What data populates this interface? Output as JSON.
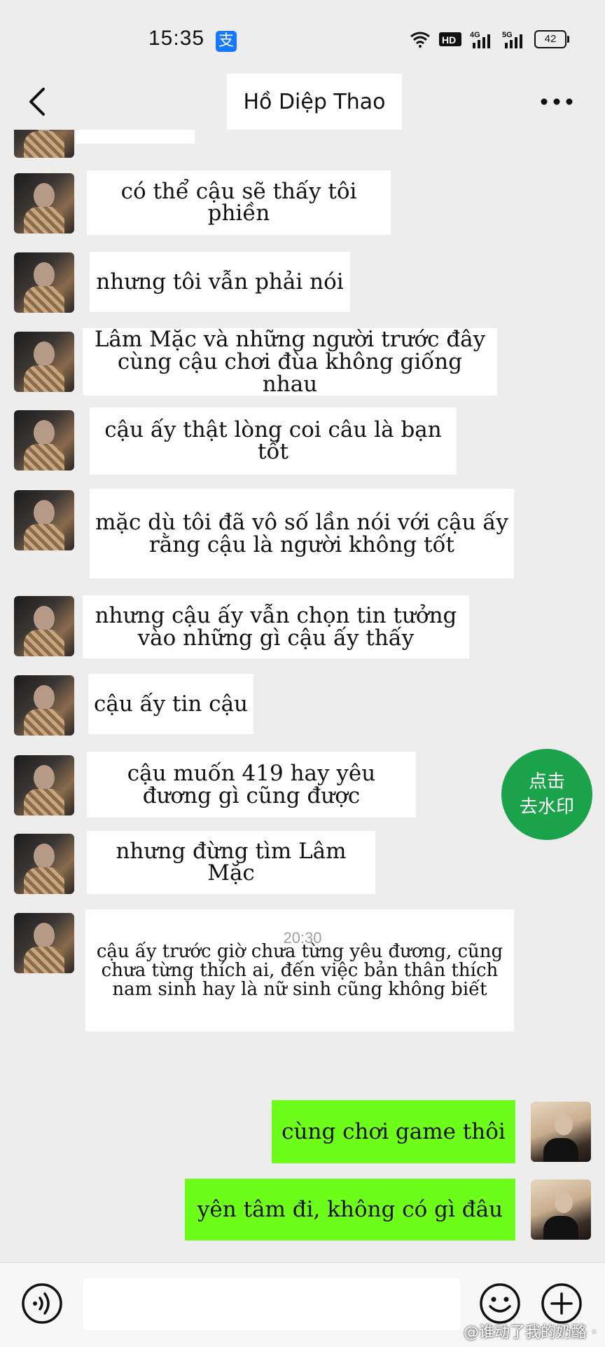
{
  "status_bar": {
    "time": "15:35",
    "app_icon": "alipay-icon",
    "network_labels": [
      "HD",
      "4G",
      "5G"
    ],
    "battery": "42"
  },
  "header": {
    "title": "Hồ Diệp Thao",
    "back_icon": "chevron-left-icon",
    "more_icon": "more-dots-icon"
  },
  "messages": [
    {
      "sender": "other",
      "text": "có thể cậu sẽ thấy tôi phiền"
    },
    {
      "sender": "other",
      "text": "nhưng tôi vẫn phải nói"
    },
    {
      "sender": "other",
      "text": "Lâm Mặc và những người trước đây\ncùng cậu chơi đùa không giống nhau"
    },
    {
      "sender": "other",
      "text": "cậu ấy thật lòng coi câu là bạn tốt"
    },
    {
      "sender": "other",
      "text": "mặc dù tôi đã vô số lần nói với cậu ấy\nrằng cậu là người không tốt"
    },
    {
      "sender": "other",
      "text": "nhưng cậu ấy vẫn chọn tin tưởng\nvào những gì cậu ấy thấy"
    },
    {
      "sender": "other",
      "text": "cậu ấy tin cậu"
    },
    {
      "sender": "other",
      "text": "cậu muốn 419 hay yêu\nđương gì cũng được"
    },
    {
      "sender": "other",
      "text": "nhưng đừng tìm Lâm Mặc"
    },
    {
      "sender": "other",
      "text": "cậu ấy trước giờ chưa từng yêu đương, cũng\nchưa từng thích ai, đến việc bản thân thích\nnam sinh hay là nữ sinh cũng không biết"
    },
    {
      "sender": "me",
      "text": "cùng chơi game thôi"
    },
    {
      "sender": "me",
      "text": "yên tâm đi, không có gì đâu"
    }
  ],
  "timestamp": "20:30",
  "watermark_button": {
    "line1": "点击",
    "line2": "去水印"
  },
  "credit": "@谁动了我的奶酪 ·",
  "colors": {
    "background": "#ededed",
    "my_bubble": "#6dff1a",
    "their_bubble": "#ffffff",
    "watermark_button": "#1aa34a"
  }
}
